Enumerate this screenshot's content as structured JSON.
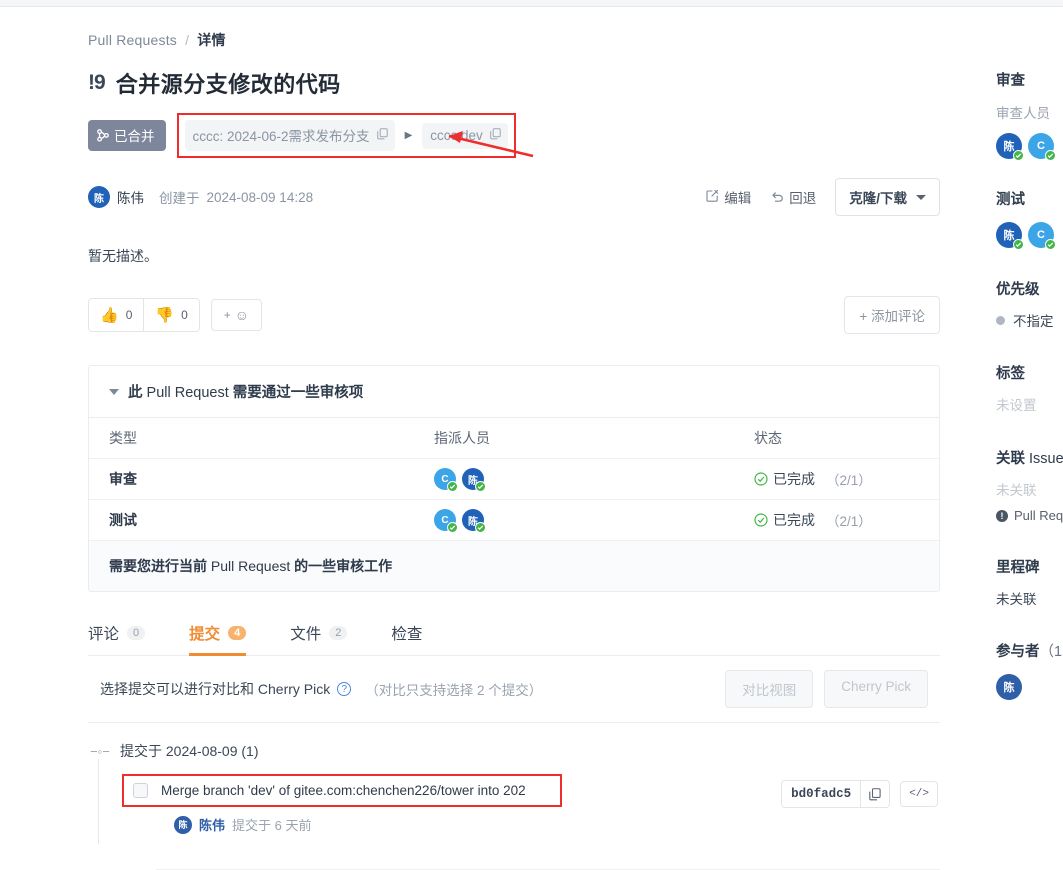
{
  "theme": {
    "accent": "#f08c32",
    "merged_badge_bg": "#7e869b",
    "annotation_red": "#ee2d2d",
    "check_green": "#44b549",
    "avatar_blue_dark": "#1f62b8",
    "avatar_blue_light": "#3ba5e8",
    "link_blue": "#2f5fa8"
  },
  "breadcrumb": {
    "root": "Pull Requests",
    "separator": "/",
    "current": "详情"
  },
  "header": {
    "pr_number": "!9",
    "title": "合并源分支修改的代码",
    "status_badge": "已合并",
    "status_icon": "merge-icon",
    "source_branch": "cccc: 2024-06-2需求发布分支",
    "target_branch": "cccc:dev",
    "arrow_icon": "play-arrow-icon",
    "copy_icon": "copy-icon"
  },
  "meta": {
    "author_initial": "陈",
    "author_name": "陈伟",
    "created_label": "创建于",
    "created_at": "2024-08-09 14:28",
    "edit_label": "编辑",
    "edit_icon": "pencil-square-icon",
    "revert_label": "回退",
    "revert_icon": "undo-arrow-icon",
    "clone_label": "克隆/下载",
    "clone_caret_icon": "chevron-down-icon"
  },
  "description": "暂无描述。",
  "reactions": {
    "thumbs_up_icon": "thumbs-up-icon",
    "thumbs_up_count": "0",
    "thumbs_down_icon": "thumbs-down-icon",
    "thumbs_down_count": "0",
    "add_emoji_label": "+",
    "add_emoji_icon": "smiley-face-icon",
    "add_comment_label": "+ 添加评论"
  },
  "review_panel": {
    "collapse_icon": "triangle-down-icon",
    "heading_strong": "此",
    "heading_mid": " Pull Request ",
    "heading_tail": "需要通过一些审核项",
    "columns": [
      "类型",
      "指派人员",
      "状态"
    ],
    "rows": [
      {
        "type": "审查",
        "assignees": [
          {
            "initial": "C",
            "color": "#3ba5e8",
            "verified": true
          },
          {
            "initial": "陈",
            "color": "#1f62b8",
            "verified": true
          }
        ],
        "status_icon": "check-circle-icon",
        "status": "已完成",
        "count": "（2/1）"
      },
      {
        "type": "测试",
        "assignees": [
          {
            "initial": "C",
            "color": "#3ba5e8",
            "verified": true
          },
          {
            "initial": "陈",
            "color": "#1f62b8",
            "verified": true
          }
        ],
        "status_icon": "check-circle-icon",
        "status": "已完成",
        "count": "（2/1）"
      }
    ],
    "footer_a": "需要您进行当前 ",
    "footer_b": "Pull Request",
    "footer_c": " 的一些审核工作"
  },
  "tabs": [
    {
      "label": "评论",
      "count": "0",
      "active": false
    },
    {
      "label": "提交",
      "count": "4",
      "active": true
    },
    {
      "label": "文件",
      "count": "2",
      "active": false
    },
    {
      "label": "检查",
      "count": "",
      "active": false
    }
  ],
  "cherry_bar": {
    "text": "选择提交可以进行对比和 Cherry Pick",
    "help_icon": "question-mark-icon",
    "note": "（对比只支持选择 2 个提交）",
    "compare_button": "对比视图",
    "cherry_pick_button": "Cherry Pick"
  },
  "commits": {
    "node_icon": "commit-node-icon",
    "group_label": "提交于 2024-08-09 (1)",
    "items": [
      {
        "checkbox_checked": false,
        "message": "Merge branch 'dev' of gitee.com:chenchen226/tower into 202",
        "author_initial": "陈",
        "author_name": "陈伟",
        "author_time": "提交于 6 天前",
        "sha": "bd0fadc5",
        "copy_icon": "copy-icon",
        "code_icon": "code-brackets-icon"
      }
    ]
  },
  "sidebar": {
    "sections": [
      {
        "title": "审查",
        "subtitle": "审查人员",
        "avatars": [
          {
            "initial": "陈",
            "color": "#1f62b8",
            "verified": true
          },
          {
            "initial": "C",
            "color": "#3ba5e8",
            "verified": true
          }
        ]
      },
      {
        "title": "测试",
        "avatars": [
          {
            "initial": "陈",
            "color": "#1f62b8",
            "verified": true
          },
          {
            "initial": "C",
            "color": "#3ba5e8",
            "verified": true
          }
        ]
      },
      {
        "title": "优先级",
        "value": "不指定",
        "dot_icon": "priority-dot-icon"
      },
      {
        "title": "标签",
        "muted": "未设置"
      },
      {
        "title_strong": "关联",
        "title_rest": " Issue",
        "muted": "未关联",
        "link_icon": "info-circle-icon",
        "link": "Pull Reque"
      },
      {
        "title": "里程碑",
        "value_plain": "未关联"
      },
      {
        "title_strong": "参与者",
        "title_rest": "（1",
        "avatars": [
          {
            "initial": "陈",
            "color": "#2f5fa8",
            "verified": false
          }
        ]
      }
    ]
  }
}
